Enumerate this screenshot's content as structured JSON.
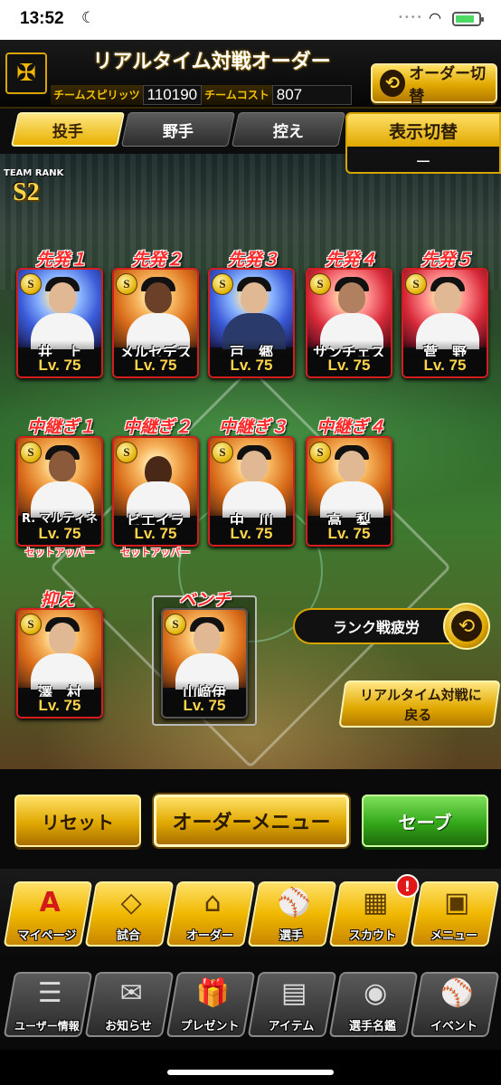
{
  "status_bar": {
    "time": "13:52",
    "moon": "☾",
    "dots": "••••",
    "wifi": "◠"
  },
  "header": {
    "title": "リアルタイム対戦オーダー",
    "spirits_label": "チームスピリッツ",
    "spirits_value": "110190",
    "cost_label": "チームコスト",
    "cost_value": "807",
    "order_switch_label": "オーダー切替"
  },
  "tabs": [
    {
      "label": "投手",
      "active": true
    },
    {
      "label": "野手",
      "active": false
    },
    {
      "label": "控え",
      "active": false
    }
  ],
  "display_switch": {
    "label": "表示切替",
    "value": "ー"
  },
  "team_rank": {
    "label": "TEAM RANK",
    "value": "S2"
  },
  "starters": [
    {
      "slot": "先発１",
      "name": "井　上",
      "level": "Lv. 75",
      "grade": "S"
    },
    {
      "slot": "先発２",
      "name": "メルセデス",
      "level": "Lv. 75",
      "grade": "S"
    },
    {
      "slot": "先発３",
      "name": "戸　郷",
      "level": "Lv. 75",
      "grade": "S"
    },
    {
      "slot": "先発４",
      "name": "サンチェス",
      "level": "Lv. 75",
      "grade": "S"
    },
    {
      "slot": "先発５",
      "name": "菅　野",
      "level": "Lv. 75",
      "grade": "S"
    }
  ],
  "relievers": [
    {
      "slot": "中継ぎ１",
      "name": "R. マルティネス",
      "level": "Lv. 75",
      "grade": "S",
      "role": "セットアッパー"
    },
    {
      "slot": "中継ぎ２",
      "name": "ビエイラ",
      "level": "Lv. 75",
      "grade": "S",
      "role": "セットアッパー"
    },
    {
      "slot": "中継ぎ３",
      "name": "中　川",
      "level": "Lv. 75",
      "grade": "S",
      "role": ""
    },
    {
      "slot": "中継ぎ４",
      "name": "高　梨",
      "level": "Lv. 75",
      "grade": "S",
      "role": ""
    }
  ],
  "closer": {
    "slot": "抑え",
    "name": "澤　村",
    "level": "Lv. 75",
    "grade": "S"
  },
  "bench": {
    "slot": "ベンチ",
    "name": "山﨑伊",
    "level": "Lv. 75",
    "grade": "S"
  },
  "fatigue_label": "ランク戦疲労",
  "back_button": {
    "line1": "リアルタイム対戦に",
    "line2": "戻る"
  },
  "actions": {
    "reset": "リセット",
    "order_menu": "オーダーメニュー",
    "save": "セーブ"
  },
  "nav_main": [
    {
      "label": "マイページ",
      "icon": "A"
    },
    {
      "label": "試合",
      "icon": "◇"
    },
    {
      "label": "オーダー",
      "icon": "⌂"
    },
    {
      "label": "選手",
      "icon": "⚾"
    },
    {
      "label": "スカウト",
      "icon": "▦",
      "badge": "!"
    },
    {
      "label": "メニュー",
      "icon": "▣"
    }
  ],
  "nav_sub": [
    {
      "label": "ユーザー情報",
      "icon": "☰"
    },
    {
      "label": "お知らせ",
      "icon": "✉"
    },
    {
      "label": "プレゼント",
      "icon": "🎁"
    },
    {
      "label": "アイテム",
      "icon": "▤"
    },
    {
      "label": "選手名鑑",
      "icon": "◉"
    },
    {
      "label": "イベント",
      "icon": "⚾"
    }
  ]
}
